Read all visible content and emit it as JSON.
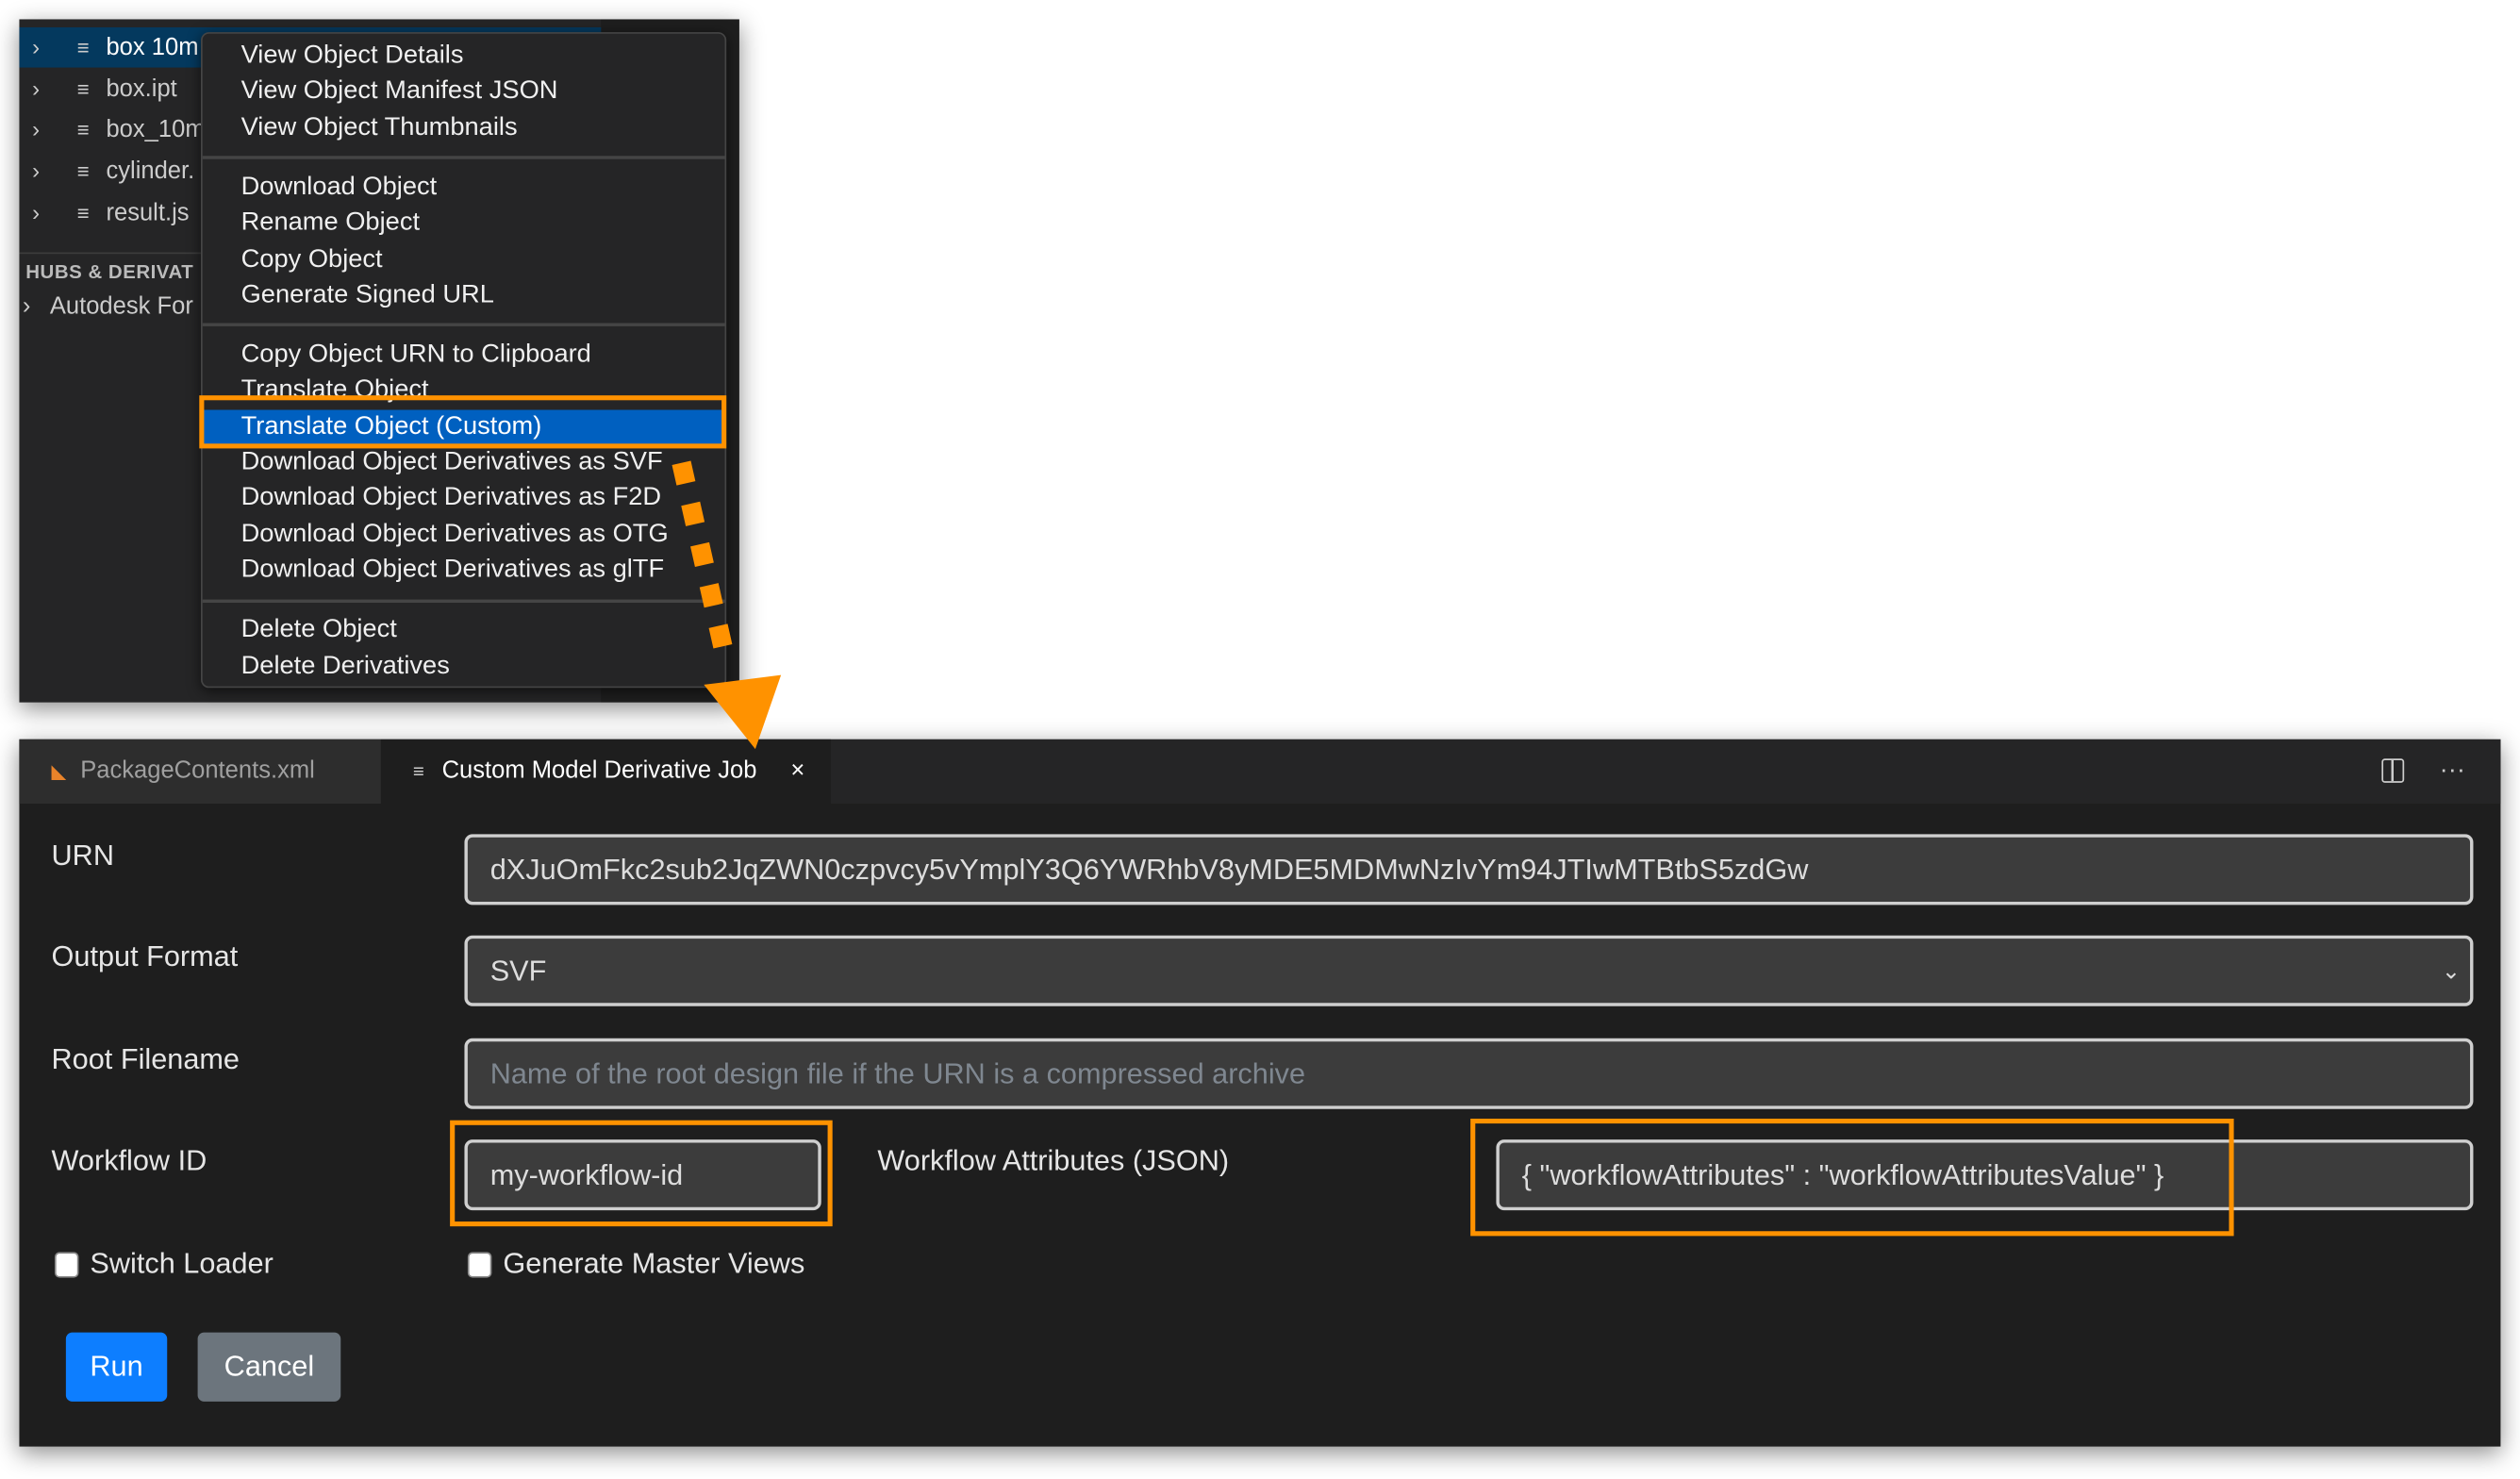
{
  "explorer": {
    "items": [
      {
        "label": "box 10m",
        "selected": true
      },
      {
        "label": "box.ipt"
      },
      {
        "label": "box_10m"
      },
      {
        "label": "cylinder."
      },
      {
        "label": "result.js"
      }
    ],
    "section_title": "HUBS & DERIVAT",
    "hub_item": "Autodesk For"
  },
  "context_menu": {
    "groups": [
      [
        "View Object Details",
        "View Object Manifest JSON",
        "View Object Thumbnails"
      ],
      [
        "Download Object",
        "Rename Object",
        "Copy Object",
        "Generate Signed URL"
      ],
      [
        "Copy Object URN to Clipboard",
        "Translate Object",
        "Translate Object (Custom)",
        "Download Object Derivatives as SVF",
        "Download Object Derivatives as F2D",
        "Download Object Derivatives as OTG",
        "Download Object Derivatives as glTF"
      ],
      [
        "Delete Object",
        "Delete Derivatives"
      ]
    ],
    "highlighted": "Translate Object (Custom)"
  },
  "editor": {
    "tabs": [
      {
        "label": "PackageContents.xml",
        "icon": "rss-icon",
        "active": false
      },
      {
        "label": "Custom Model Derivative Job",
        "icon": "file-lines-icon",
        "active": true,
        "close": "×"
      }
    ],
    "actions": {
      "split": "split-editor-icon",
      "more": "···"
    }
  },
  "form": {
    "urn_label": "URN",
    "urn_value": "dXJuOmFkc2sub2JqZWN0czpvcy5vYmplY3Q6YWRhbV8yMDE5MDMwNzIvYm94JTIwMTBtbS5zdGw",
    "output_format_label": "Output Format",
    "output_format_value": "SVF",
    "root_filename_label": "Root Filename",
    "root_filename_placeholder": "Name of the root design file if the URN is a compressed archive",
    "workflow_id_label": "Workflow ID",
    "workflow_id_value": "my-workflow-id",
    "workflow_attributes_label": "Workflow Attributes (JSON)",
    "workflow_attributes_value": "{ \"workflowAttributes\" : \"workflowAttributesValue\" }",
    "switch_loader_label": "Switch Loader",
    "switch_loader_checked": false,
    "master_views_label": "Generate Master Views",
    "master_views_checked": false,
    "run_label": "Run",
    "cancel_label": "Cancel"
  },
  "colors": {
    "highlight": "#ff9200",
    "menu_selection": "#0060c0",
    "run_button": "#0d7eff",
    "cancel_button": "#6c757d"
  }
}
